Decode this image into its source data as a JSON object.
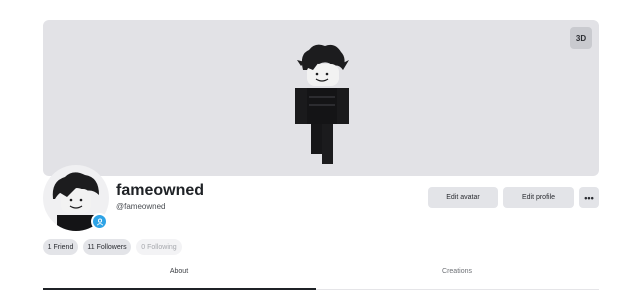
{
  "banner": {
    "view_3d_label": "3D"
  },
  "profile": {
    "display_name": "fameowned",
    "handle": "@fameowned"
  },
  "actions": {
    "edit_avatar": "Edit avatar",
    "edit_profile": "Edit profile",
    "more": "•••"
  },
  "stats": {
    "friends": "1 Friend",
    "followers": "11 Followers",
    "following": "0 Following"
  },
  "tabs": [
    {
      "label": "About",
      "active": true
    },
    {
      "label": "Creations",
      "active": false
    }
  ],
  "colors": {
    "banner_bg": "#e2e2e6",
    "badge_blue": "#2ea3e6",
    "button_bg": "#e3e4e8"
  }
}
